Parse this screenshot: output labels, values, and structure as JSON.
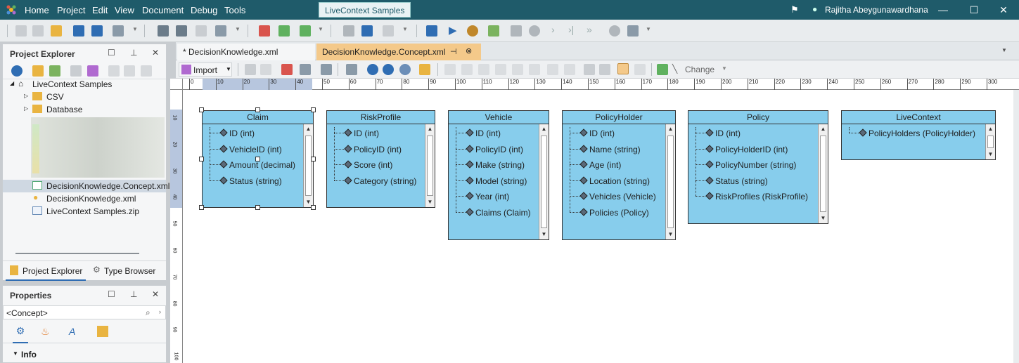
{
  "menu": {
    "items": [
      "Home",
      "Project",
      "Edit",
      "View",
      "Document",
      "Debug",
      "Tools"
    ],
    "app_title": "LiveContext Samples",
    "user": "Rajitha Abeygunawardhana"
  },
  "project_explorer": {
    "title": "Project Explorer",
    "root": "LiveContext Samples",
    "folders": [
      "CSV",
      "Database"
    ],
    "files": [
      "DecisionKnowledge.Concept.xml",
      "DecisionKnowledge.xml",
      "LiveContext Samples.zip"
    ],
    "bottom_tabs": [
      "Project Explorer",
      "Type Browser"
    ]
  },
  "properties": {
    "title": "Properties",
    "selector": "<Concept>",
    "section": "Info"
  },
  "editor": {
    "tabs": [
      "* DecisionKnowledge.xml",
      "DecisionKnowledge.Concept.xml"
    ],
    "import_label": "Import",
    "change_label": "Change",
    "ruler": [
      "0",
      "10",
      "20",
      "30",
      "40",
      "50",
      "60",
      "70",
      "80",
      "90",
      "100",
      "110",
      "120",
      "130",
      "140",
      "150",
      "160",
      "170",
      "180",
      "190",
      "200",
      "210",
      "220",
      "230",
      "240",
      "250",
      "260",
      "270",
      "280",
      "290",
      "300"
    ],
    "vruler": [
      "10",
      "20",
      "30",
      "40",
      "50",
      "60",
      "70",
      "80",
      "90",
      "100"
    ]
  },
  "entities": [
    {
      "name": "Claim",
      "attrs": [
        "ID (int)",
        "VehicleID (int)",
        "Amount (decimal)",
        "Status (string)"
      ]
    },
    {
      "name": "RiskProfile",
      "attrs": [
        "ID (int)",
        "PolicyID (int)",
        "Score (int)",
        "Category (string)"
      ]
    },
    {
      "name": "Vehicle",
      "attrs": [
        "ID (int)",
        "PolicyID (int)",
        "Make (string)",
        "Model (string)",
        "Year (int)",
        "Claims (Claim)"
      ]
    },
    {
      "name": "PolicyHolder",
      "attrs": [
        "ID (int)",
        "Name (string)",
        "Age (int)",
        "Location (string)",
        "Vehicles (Vehicle)",
        "Policies (Policy)"
      ]
    },
    {
      "name": "Policy",
      "attrs": [
        "ID (int)",
        "PolicyHolderID (int)",
        "PolicyNumber (string)",
        "Status (string)",
        "RiskProfiles (RiskProfile)"
      ]
    },
    {
      "name": "LiveContext",
      "attrs": [
        "PolicyHolders (PolicyHolder)"
      ]
    }
  ]
}
